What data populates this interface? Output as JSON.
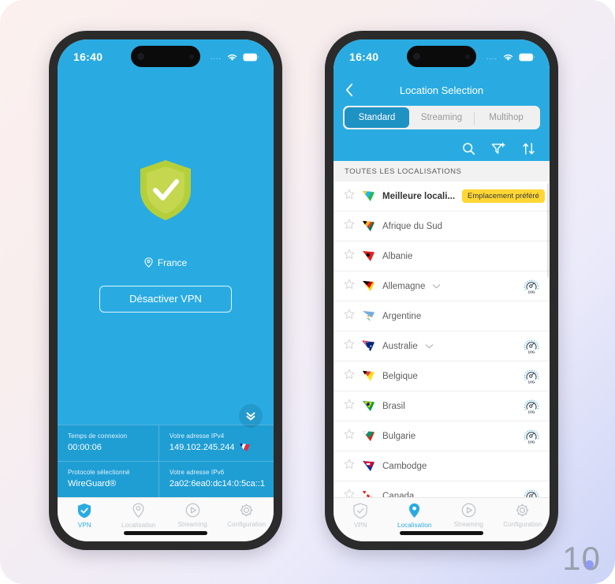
{
  "watermark": {
    "text": "10"
  },
  "colors": {
    "brand_blue": "#29ABE2",
    "panel_blue": "#1f9ed4",
    "segment_active": "#1f92c4",
    "badge_yellow": "#FFD633",
    "shield_green": "#B5CF3A",
    "tab_inactive": "#c2c7cc"
  },
  "phone_left": {
    "statusbar": {
      "time": "16:40",
      "signal_dots": "....",
      "wifi_icon": "wifi-icon",
      "battery_icon": "battery-icon"
    },
    "vpn": {
      "shield_icon": "shield-check-icon",
      "location_pin_icon": "location-pin-icon",
      "location": "France",
      "disconnect_label": "Désactiver VPN",
      "expand_icon": "chevron-double-down-icon"
    },
    "info": [
      {
        "label": "Temps de connexion",
        "value": "00:00:06",
        "flag": null
      },
      {
        "label": "Votre adresse IPv4",
        "value": "149.102.245.244",
        "flag": "france-flag-icon"
      },
      {
        "label": "Protocole sélectionné",
        "value": "WireGuard®",
        "flag": null
      },
      {
        "label": "Votre adresse IPv6",
        "value": "2a02:6ea0:dc14:0:5ca::1",
        "flag": null
      }
    ],
    "tabs": [
      {
        "label": "VPN",
        "icon": "shield-icon",
        "active": true
      },
      {
        "label": "Localisation",
        "icon": "location-pin-icon",
        "active": false
      },
      {
        "label": "Streaming",
        "icon": "play-circle-icon",
        "active": false
      },
      {
        "label": "Configuration",
        "icon": "gear-icon",
        "active": false
      }
    ]
  },
  "phone_right": {
    "statusbar": {
      "time": "16:40",
      "signal_dots": "....",
      "wifi_icon": "wifi-icon",
      "battery_icon": "battery-icon"
    },
    "header": {
      "back_icon": "chevron-left-icon",
      "title": "Location Selection",
      "segments": [
        {
          "label": "Standard",
          "active": true
        },
        {
          "label": "Streaming",
          "active": false
        },
        {
          "label": "Multihop",
          "active": false
        }
      ],
      "actions": [
        {
          "name": "search-icon"
        },
        {
          "name": "filter-add-icon"
        },
        {
          "name": "sort-icon"
        }
      ]
    },
    "list_header": "TOUTES LES LOCALISATIONS",
    "rows": [
      {
        "name": "Meilleure locali...",
        "flag": "gradient-flag-icon",
        "badge": "Emplacement préféré",
        "pin": true,
        "expandable": false,
        "speed": false,
        "best": true
      },
      {
        "name": "Afrique du Sud",
        "flag": "south-africa-flag-icon",
        "badge": null,
        "pin": false,
        "expandable": false,
        "speed": false,
        "best": false
      },
      {
        "name": "Albanie",
        "flag": "albania-flag-icon",
        "badge": null,
        "pin": false,
        "expandable": false,
        "speed": false,
        "best": false
      },
      {
        "name": "Allemagne",
        "flag": "germany-flag-icon",
        "badge": null,
        "pin": false,
        "expandable": true,
        "speed": true,
        "best": false
      },
      {
        "name": "Argentine",
        "flag": "argentina-flag-icon",
        "badge": null,
        "pin": false,
        "expandable": false,
        "speed": false,
        "best": false
      },
      {
        "name": "Australie",
        "flag": "australia-flag-icon",
        "badge": null,
        "pin": false,
        "expandable": true,
        "speed": true,
        "best": false
      },
      {
        "name": "Belgique",
        "flag": "belgium-flag-icon",
        "badge": null,
        "pin": false,
        "expandable": false,
        "speed": true,
        "best": false
      },
      {
        "name": "Brasil",
        "flag": "brazil-flag-icon",
        "badge": null,
        "pin": false,
        "expandable": false,
        "speed": true,
        "best": false
      },
      {
        "name": "Bulgarie",
        "flag": "bulgaria-flag-icon",
        "badge": null,
        "pin": false,
        "expandable": false,
        "speed": true,
        "best": false
      },
      {
        "name": "Cambodge",
        "flag": "cambodia-flag-icon",
        "badge": null,
        "pin": false,
        "expandable": false,
        "speed": false,
        "best": false
      },
      {
        "name": "Canada",
        "flag": "canada-flag-icon",
        "badge": null,
        "pin": false,
        "expandable": false,
        "speed": true,
        "best": false
      }
    ],
    "speed_badge_label": "10G",
    "tabs": [
      {
        "label": "VPN",
        "icon": "shield-icon",
        "active": false
      },
      {
        "label": "Localisation",
        "icon": "location-pin-icon",
        "active": true
      },
      {
        "label": "Streaming",
        "icon": "play-circle-icon",
        "active": false
      },
      {
        "label": "Configuration",
        "icon": "gear-icon",
        "active": false
      }
    ]
  }
}
